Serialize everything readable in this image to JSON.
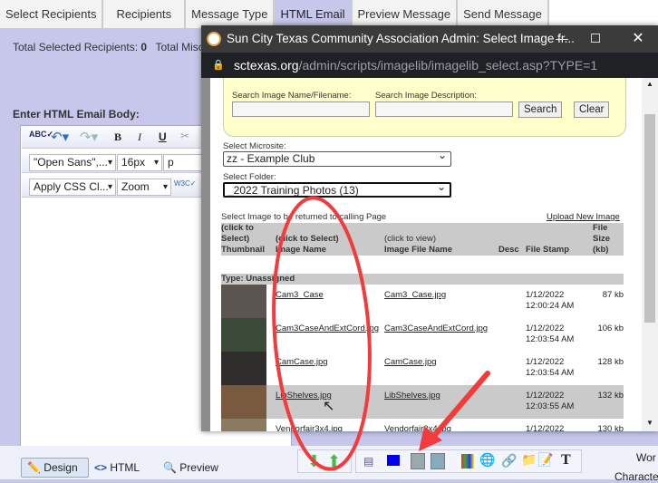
{
  "tabs": [
    "Select Recipients",
    "Recipients",
    "Message Type",
    "HTML Email",
    "Preview Message",
    "Send Message"
  ],
  "active_tab": "HTML Email",
  "totals": {
    "selected_label": "Total Selected Recipients:",
    "selected_value": "0",
    "misc_label": "Total Misc"
  },
  "editor": {
    "label": "Enter HTML Email Body:",
    "font": "\"Open Sans\",...",
    "size": "16px",
    "block": "p",
    "css_class": "Apply CSS Cl...",
    "zoom": "Zoom"
  },
  "bottom": {
    "design": "Design",
    "html": "HTML",
    "preview": "Preview",
    "words": "Wor",
    "chars": "Characte"
  },
  "popup": {
    "title": "Sun City Texas Community Association Admin: Select Image fr...",
    "url_host": "sctexas.org",
    "url_path": "/admin/scripts/imagelib/imagelib_select.asp?TYPE=1",
    "search_name_label": "Search Image Name/Filename:",
    "search_name_value": "",
    "search_desc_label": "Search Image Description:",
    "search_desc_value": "",
    "search_button": "Search",
    "clear_button": "Clear",
    "microsite_label": "Select Microsite:",
    "microsite_value": "zz - Example Club",
    "folder_label": "Select Folder:",
    "folder_value": "_2022 Training Photos (13)",
    "select_instruction": "Select Image to be returned to calling Page",
    "upload_link": "Upload New Image",
    "headers": {
      "thumb": "(click to Select) Thumbnail",
      "name_hint": "(click to Select)",
      "name": "Image Name",
      "file_hint": "(click to view)",
      "file": "Image File Name",
      "desc": "Desc",
      "stamp": "File Stamp",
      "size": "File Size (kb)"
    },
    "type_label": "Type: Unassigned",
    "rows": [
      {
        "name": "Cam3_Case",
        "file": "Cam3_Case.jpg",
        "date": "1/12/2022",
        "time": "12:00:24 AM",
        "size": "87 kb",
        "thumb": "#5a5550"
      },
      {
        "name": "Cam3CaseAndExtCord.jpg",
        "file": "Cam3CaseAndExtCord.jpg",
        "date": "1/12/2022",
        "time": "12:03:54 AM",
        "size": "106 kb",
        "thumb": "#3c4a3a"
      },
      {
        "name": "CamCase.jpg",
        "file": "CamCase.jpg",
        "date": "1/12/2022",
        "time": "12:03:54 AM",
        "size": "128 kb",
        "thumb": "#2f2d2b"
      },
      {
        "name": "LibShelves.jpg",
        "file": "LibShelves.jpg",
        "date": "1/12/2022",
        "time": "12:03:55 AM",
        "size": "132 kb",
        "thumb": "#7a5a3e"
      },
      {
        "name": "Vendorfair3x4.jpg",
        "file": "Vendorfair3x4.jpg",
        "date": "1/12/2022",
        "time": "",
        "size": "130 kb",
        "thumb": "#8a7a60"
      }
    ],
    "highlight_row": 3
  },
  "colors": {
    "annotation": "#f03c3c",
    "search_panel": "#ffffcc"
  }
}
